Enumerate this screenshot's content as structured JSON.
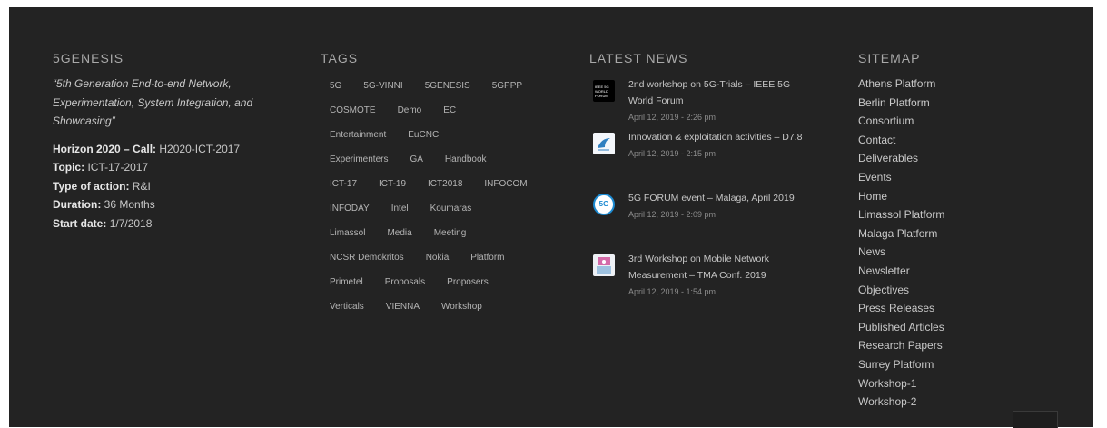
{
  "about": {
    "title": "5GENESIS",
    "quote": "“5th Generation End-to-end Network, Experimentation, System Integration, and Showcasing”",
    "lines": [
      {
        "label": "Horizon 2020 – Call:",
        "value": "H2020-ICT-2017"
      },
      {
        "label": "Topic:",
        "value": "ICT-17-2017"
      },
      {
        "label": "Type of action:",
        "value": "R&I"
      },
      {
        "label": "Duration:",
        "value": "36 Months"
      },
      {
        "label": "Start date:",
        "value": "1/7/2018"
      }
    ]
  },
  "tags": {
    "title": "TAGS",
    "rows": [
      [
        "5G",
        "5G-VINNI",
        "5GENESIS",
        "5GPPP"
      ],
      [
        "COSMOTE",
        "Demo",
        "EC"
      ],
      [
        "Entertainment",
        "EuCNC"
      ],
      [
        "Experimenters",
        "GA",
        "Handbook"
      ],
      [
        "ICT-17",
        "ICT-19",
        "ICT2018",
        "INFOCOM"
      ],
      [
        "INFODAY",
        "Intel",
        "Koumaras"
      ],
      [
        "Limassol",
        "Media",
        "Meeting"
      ],
      [
        "NCSR Demokritos",
        "Nokia",
        "Platform"
      ],
      [
        "Primetel",
        "Proposals",
        "Proposers"
      ],
      [
        "Verticals",
        "VIENNA",
        "Workshop"
      ]
    ]
  },
  "news": {
    "title": "LATEST NEWS",
    "items": [
      {
        "title": "2nd workshop on 5G-Trials – IEEE 5G World Forum",
        "date": "April 12, 2019 - 2:26 pm",
        "thumb": "forum-logo-icon",
        "thumb_text": "IEEE 5G WORLD FORUM"
      },
      {
        "title": "Innovation & exploitation activities – D7.8",
        "date": "April 12, 2019 - 2:15 pm",
        "thumb": "bird-logo-icon"
      },
      {
        "title": "5G FORUM event – Malaga, April 2019",
        "date": "April 12, 2019 - 2:09 pm",
        "thumb": "5g-logo-icon",
        "thumb_text": "5G"
      },
      {
        "title": "3rd Workshop on Mobile Network Measurement – TMA Conf. 2019",
        "date": "April 12, 2019 - 1:54 pm",
        "thumb": "tma-logo-icon"
      }
    ]
  },
  "sitemap": {
    "title": "SITEMAP",
    "links": [
      "Athens Platform",
      "Berlin Platform",
      "Consortium",
      "Contact",
      "Deliverables",
      "Events",
      "Home",
      "Limassol Platform",
      "Malaga Platform",
      "News",
      "Newsletter",
      "Objectives",
      "Press Releases",
      "Published Articles",
      "Research Papers",
      "Surrey Platform",
      "Workshop-1",
      "Workshop-2"
    ]
  },
  "colors": {
    "background": "#232323",
    "text": "#c8c8c8",
    "heading": "#a9a9a9"
  }
}
